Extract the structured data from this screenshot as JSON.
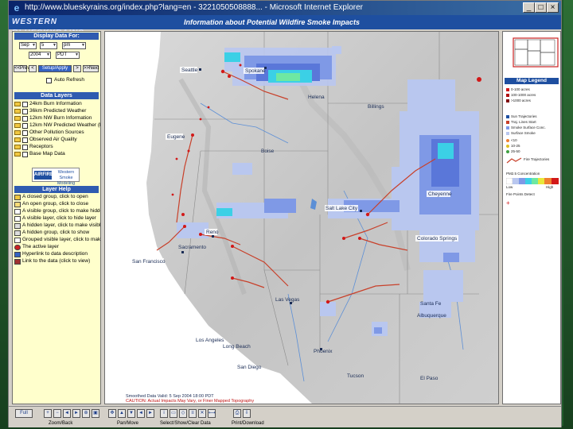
{
  "window": {
    "title": "http://www.blueskyrains.org/index.php?lang=en - 3221050508888... - Microsoft Internet Explorer"
  },
  "header": {
    "brand": "WESTERN BLUESKYRAINS",
    "title": "Information about Potential Wildfire Smoke Impacts"
  },
  "controls": {
    "display_heading": "Display Data For:",
    "month": "Sep",
    "day": "5",
    "hour": "pm",
    "year": "2004",
    "tz": "PDT",
    "prev": "<<Prev",
    "dec": "<",
    "active": "Setup/Apply",
    "inc": ">",
    "next": ">>Next",
    "auto_refresh": "Auto Refresh"
  },
  "data_layers": {
    "heading": "Data Layers",
    "items": [
      "24km Burn Information",
      "36km Predicted Weather",
      "12km NW Burn Information",
      "12km NW Predicted Weather (hyd)",
      "Other Pollution Sources",
      "Observed Air Quality",
      "Receptors",
      "Base Map Data"
    ],
    "logo_left": "AIRFIRE",
    "logo_right": "Western Smoke Modeling"
  },
  "layer_help": {
    "heading": "Layer Help",
    "items": [
      "A closed group, click to open",
      "An open group, click to close",
      "A visible group, click to make hidden",
      "A visible layer, click to hide layer",
      "A hidden layer, click to make visible",
      "A hidden group, click to show",
      "Grouped visible layer, click to make hidden",
      "The active layer",
      "Hyperlink to data description",
      "Link to the data (click to view)"
    ]
  },
  "map": {
    "cities": {
      "seattle": "Seattle",
      "spokane": "Spokane",
      "billings": "Billings",
      "helena": "Helena",
      "eugene": "Eugene",
      "boise": "Boise",
      "cheyenne": "Cheyenne",
      "salt_lake_city": "Salt Lake City",
      "reno": "Reno",
      "sacramento": "Sacramento",
      "san_francisco": "San Francisco",
      "colorado_springs": "Colorado Springs",
      "las_vegas": "Las Vegas",
      "santa_fe": "Santa Fe",
      "albuquerque": "Albuquerque",
      "los_angeles": "Los Angeles",
      "long_beach": "Long Beach",
      "san_diego": "San Diego",
      "phoenix": "Phoenix",
      "tucson": "Tucson",
      "el_paso": "El Paso"
    },
    "caption_line1": "Smoothed Data Valid: 5 Sep 2004 18:00 PDT",
    "caption_line2": "CAUTION: Actual Impacts May Vary, or Finer Mapped Topography",
    "colors": {
      "plume_light": "#b9c7ef",
      "plume_mid": "#7f99e6",
      "plume_dark": "#5a77d9",
      "plume_cyan": "#3bd0e6",
      "plume_green": "#6ee8a2",
      "fire_red": "#d21818",
      "trajectory": "#c8402a"
    }
  },
  "legend": {
    "title": "Map Legend",
    "items": [
      "0-100 acres",
      "100-1000 acres",
      ">1000 acres",
      "Sun Trajectories",
      "Traj. Lines Start",
      "Smoke Surface Conc.",
      "Surface Smoke",
      "<10",
      "10-25",
      "25-50",
      "Fire Trajectories",
      "PM2.5 Concentration",
      "Low",
      "High",
      "Fire Points Detect"
    ]
  },
  "toolbar": {
    "zoom": "Zoom/Back",
    "pan": "Pan/Move",
    "select": "Select/Show/Clear Data",
    "print": "Print/Download",
    "full": "Full"
  }
}
